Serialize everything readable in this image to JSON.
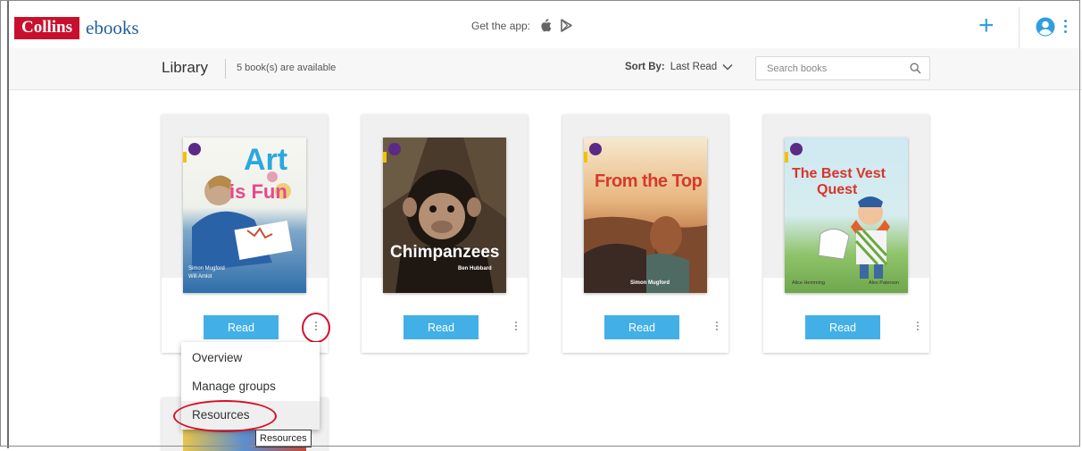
{
  "brand": {
    "logo_box": "Collins",
    "logo_word": "ebooks"
  },
  "header": {
    "get_app_label": "Get the app:",
    "icons": [
      "apple-icon",
      "google-play-icon",
      "plus-icon",
      "user-icon",
      "kebab-menu-icon"
    ],
    "accent_color": "#2f9ee0",
    "brand_red": "#c8102e"
  },
  "library": {
    "title": "Library",
    "count_text": "5 book(s) are available",
    "sort_label": "Sort By:",
    "sort_value": "Last Read",
    "search_placeholder": "Search books"
  },
  "books": [
    {
      "title_line1": "Art",
      "title_line2": "is Fun",
      "authors": [
        "Simon Mugford",
        "Will Amlot"
      ],
      "read_label": "Read"
    },
    {
      "title": "Chimpanzees",
      "author": "Ben Hubbard",
      "read_label": "Read"
    },
    {
      "title": "From the Top",
      "author": "Simon Mugford",
      "read_label": "Read"
    },
    {
      "title_line1": "The Best Vest",
      "title_line2": "Quest",
      "authors": [
        "Alice Hemming",
        "Alex Paterson"
      ],
      "read_label": "Read"
    }
  ],
  "menu": {
    "items": [
      "Overview",
      "Manage groups",
      "Resources"
    ],
    "hovered": "Resources",
    "tooltip": "Resources"
  },
  "button_color": "#42b0e6",
  "annotation_color": "#d6102a"
}
